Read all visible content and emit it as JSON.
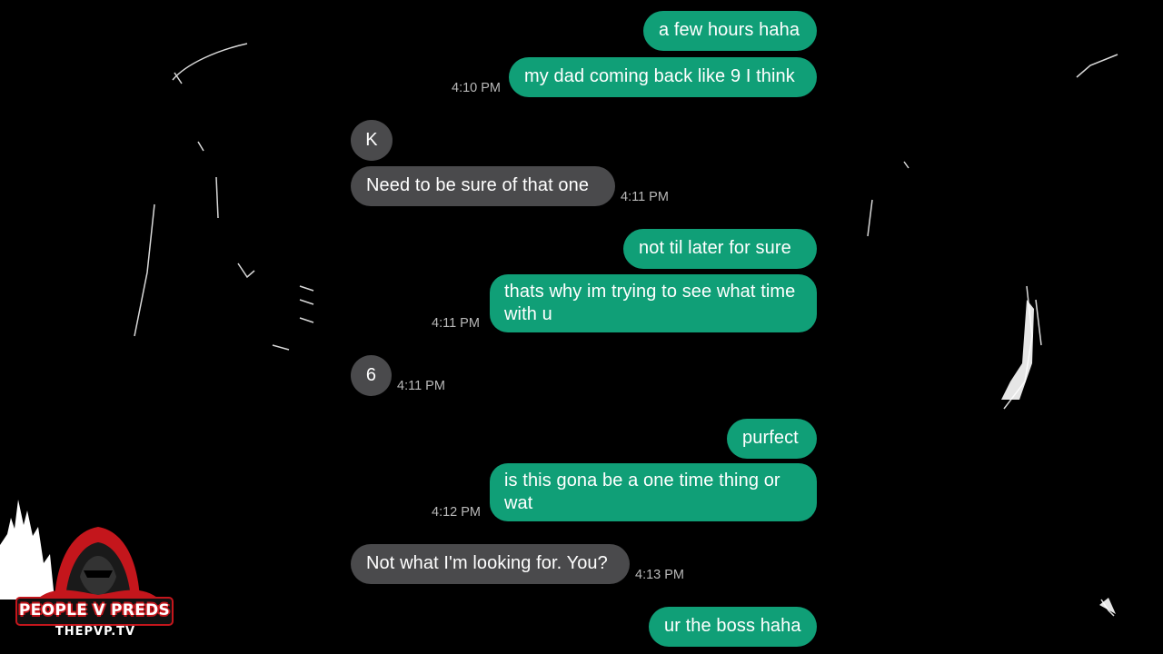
{
  "colors": {
    "sent_bubble": "#109f77",
    "received_bubble": "#4a4a4c",
    "timestamp": "#b9b9b9",
    "background": "#000000",
    "logo_red": "#c4161c"
  },
  "messages": [
    {
      "from": "me",
      "text": "a few hours haha"
    },
    {
      "from": "me",
      "text": "my dad coming back like 9 I think",
      "time": "4:10 PM"
    },
    {
      "from": "them",
      "text": "K"
    },
    {
      "from": "them",
      "text": "Need to be sure of that one",
      "time": "4:11 PM"
    },
    {
      "from": "me",
      "text": "not til later for sure"
    },
    {
      "from": "me",
      "text": "thats why im trying to see what time with u",
      "time": "4:11 PM"
    },
    {
      "from": "them",
      "text": "6",
      "time": "4:11 PM"
    },
    {
      "from": "me",
      "text": "purfect"
    },
    {
      "from": "me",
      "text": "is this gona be a one time thing or wat",
      "time": "4:12 PM"
    },
    {
      "from": "them",
      "text": "Not what I'm looking for. You?",
      "time": "4:13 PM"
    },
    {
      "from": "me",
      "text": "ur the boss haha"
    }
  ],
  "logo": {
    "title": "PEOPLE V PREDS",
    "subtitle": "THEPVP.TV",
    "icon": "hooded-figure-icon"
  }
}
